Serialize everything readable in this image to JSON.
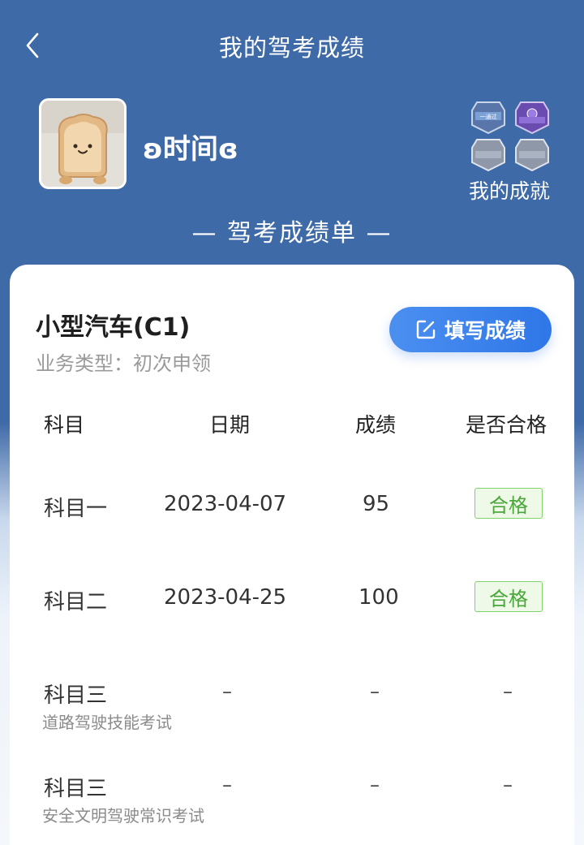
{
  "header": {
    "title": "我的驾考成绩",
    "back_icon": "chevron-left-icon"
  },
  "profile": {
    "username": "ʚ时间ɞ",
    "achievements_label": "我的成就"
  },
  "section_title": "— 驾考成绩单 —",
  "license": {
    "vehicle_type": "小型汽车(C1)",
    "business_type": "业务类型：初次申领",
    "fill_button_label": "填写成绩"
  },
  "table": {
    "headers": [
      "科目",
      "日期",
      "成绩",
      "是否合格"
    ],
    "rows": [
      {
        "subject": "科目一",
        "subtitle": "",
        "date": "2023-04-07",
        "score": "95",
        "result": "合格"
      },
      {
        "subject": "科目二",
        "subtitle": "",
        "date": "2023-04-25",
        "score": "100",
        "result": "合格"
      },
      {
        "subject": "科目三",
        "subtitle": "道路驾驶技能考试",
        "date": "–",
        "score": "–",
        "result": "–"
      },
      {
        "subject": "科目三",
        "subtitle": "安全文明驾驶常识考试",
        "date": "–",
        "score": "–",
        "result": "–"
      }
    ]
  },
  "colors": {
    "header_bg": "#3f6aa8",
    "accent": "#2f77e8",
    "pass_green": "#4aa73a"
  }
}
